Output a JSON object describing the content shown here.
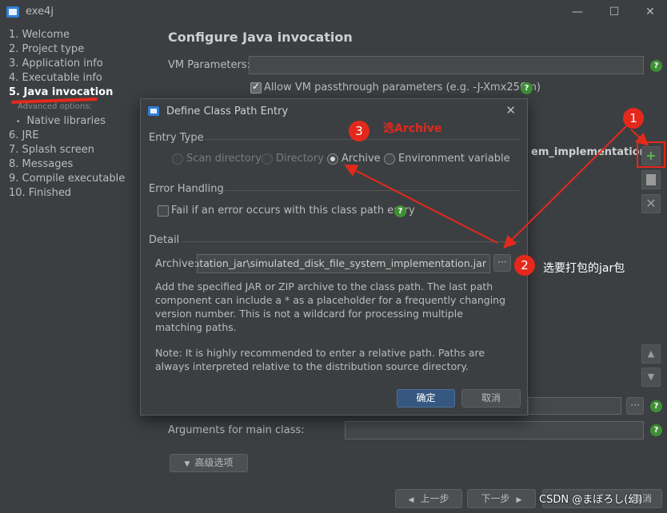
{
  "window": {
    "title": "exe4j",
    "minimize": "—",
    "maximize": "☐",
    "close": "✕"
  },
  "sidebar": {
    "items": [
      {
        "label": "1. Welcome"
      },
      {
        "label": "2. Project type"
      },
      {
        "label": "3. Application info"
      },
      {
        "label": "4. Executable info"
      },
      {
        "label": "5. Java invocation",
        "active": true
      },
      {
        "label": "6. JRE"
      },
      {
        "label": "7. Splash screen"
      },
      {
        "label": "8. Messages"
      },
      {
        "label": "9. Compile executable"
      },
      {
        "label": "10. Finished"
      }
    ],
    "advanced_heading": "Advanced options:",
    "advanced_items": [
      {
        "label": "Native libraries"
      }
    ]
  },
  "main": {
    "title": "Configure Java invocation",
    "vm_params_label": "VM Parameters:",
    "vm_params_value": "",
    "allow_passthrough_label": "Allow VM passthrough parameters (e.g. -J-Xmx256m)",
    "allow_passthrough_checked": true,
    "classpath_entry_text": "em_implementation\\o",
    "arguments_label": "Arguments for main class:",
    "arguments_value": "",
    "advanced_button": "高级选项",
    "browse_label": "···",
    "back_button": "上一步",
    "next_button": "下一步",
    "cancel_button": "取消",
    "help_glyph": "?",
    "add_glyph": "+",
    "delete_glyph": "✕",
    "up_glyph": "▲",
    "down_glyph": "▼"
  },
  "dialog": {
    "title": "Define Class Path Entry",
    "close": "✕",
    "entry_type_heading": "Entry Type",
    "entry_types": [
      {
        "label": "Scan directory",
        "enabled": false,
        "selected": false
      },
      {
        "label": "Directory",
        "enabled": false,
        "selected": false
      },
      {
        "label": "Archive",
        "enabled": true,
        "selected": true
      },
      {
        "label": "Environment variable",
        "enabled": true,
        "selected": false
      }
    ],
    "error_heading": "Error Handling",
    "fail_on_error_label": "Fail if an error occurs with this class path entry",
    "fail_on_error_checked": false,
    "detail_heading": "Detail",
    "archive_label": "Archive:",
    "archive_value": "ementation_jar\\simulated_disk_file_system_implementation.jar",
    "browse_label": "···",
    "description": "Add the specified JAR or ZIP archive to the class path. The last path component can include a * as a placeholder for a frequently changing version number. This is not a wildcard for processing multiple matching paths.",
    "note": "Note: It is highly recommended to enter a relative path. Paths are always interpreted relative to the distribution source directory.",
    "ok_button": "确定",
    "cancel_button": "取消"
  },
  "annotations": {
    "step1": "1",
    "step2": "2",
    "step3": "3",
    "step2_text": "选要打包的jar包",
    "step3_text": "选Archive",
    "color": "#e5281c"
  },
  "watermark": "CSDN @まぼろし(幻)",
  "colors": {
    "background": "#3c3f41",
    "accent": "#365880",
    "annotation": "#e5281c",
    "help": "#3f8f35"
  }
}
